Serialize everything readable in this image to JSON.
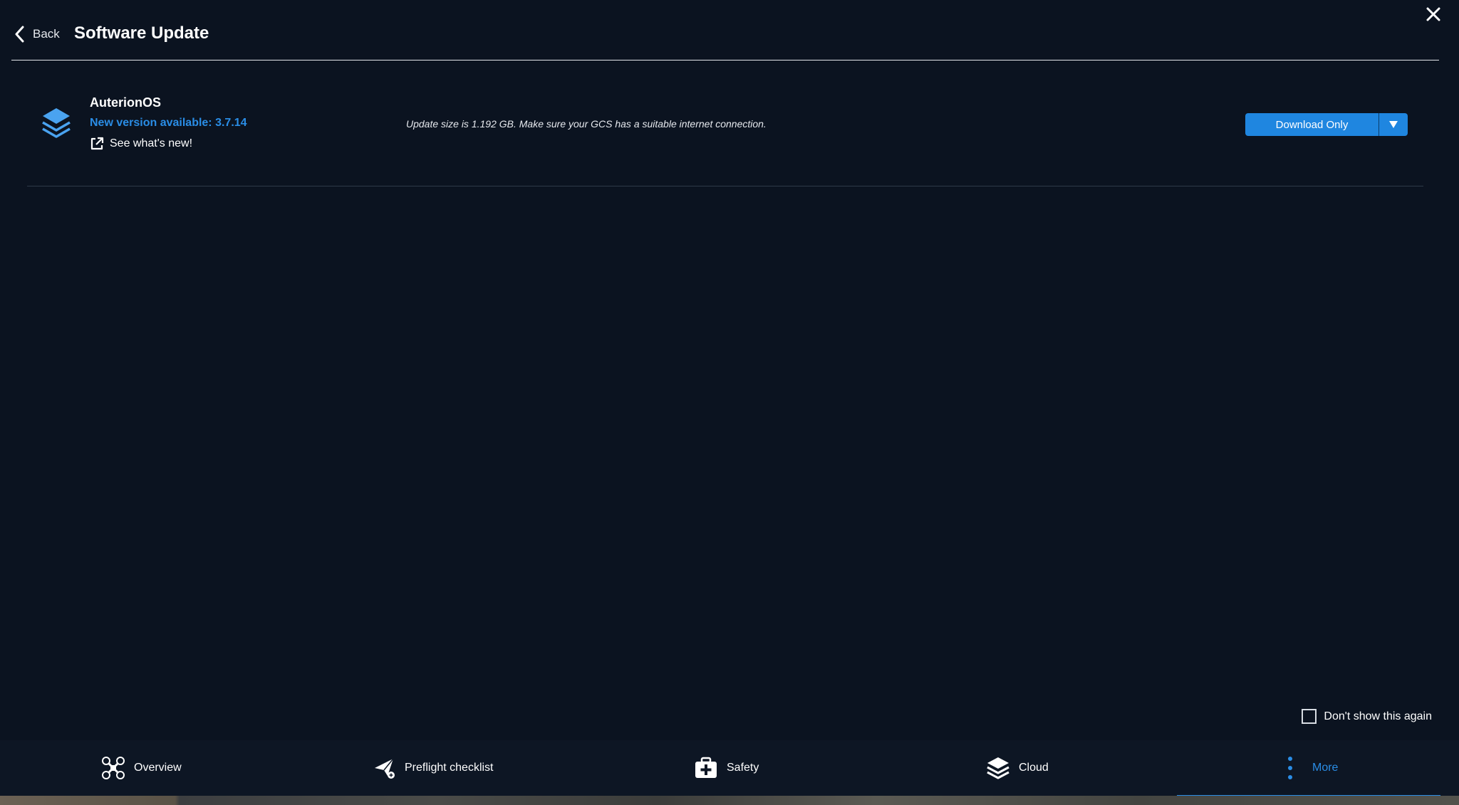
{
  "header": {
    "back_label": "Back",
    "title": "Software Update"
  },
  "update": {
    "product_name": "AuterionOS",
    "version_text": "New version available: 3.7.14",
    "whats_new_label": "See what's new!",
    "size_note": "Update size is 1.192 GB. Make sure your GCS has a suitable internet connection.",
    "download_label": "Download Only"
  },
  "footer": {
    "dont_show_label": "Don't show this again",
    "dont_show_checked": false
  },
  "nav": {
    "items": [
      {
        "label": "Overview",
        "icon": "drone-icon"
      },
      {
        "label": "Preflight checklist",
        "icon": "plane-check-icon"
      },
      {
        "label": "Safety",
        "icon": "first-aid-icon"
      },
      {
        "label": "Cloud",
        "icon": "layers-icon"
      },
      {
        "label": "More",
        "icon": "more-vertical-icon"
      }
    ],
    "active": "More"
  },
  "colors": {
    "background": "#0b1320",
    "accent": "#2a8de6",
    "button": "#1f86e0"
  }
}
